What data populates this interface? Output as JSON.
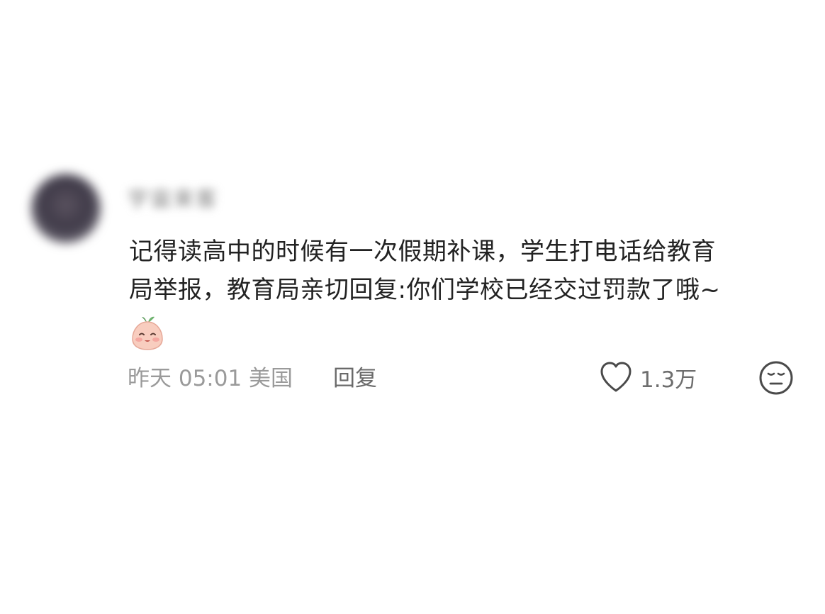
{
  "comment": {
    "username": "宇宙来客",
    "text_lines": [
      "记得读高中的时候有一次假期补课，学生打电话给教育",
      "局举报，教育局亲切回复:你们学校已经交过罚款了哦~"
    ],
    "emoji_icon": "smiling-peach-emoji-icon",
    "timestamp": "昨天 05:01 美国",
    "reply_label": "回复",
    "like_count": "1.3万",
    "like_icon": "heart-outline-icon",
    "reaction_icon": "expressionless-face-icon"
  },
  "colors": {
    "text": "#222222",
    "meta": "#9a9a9a",
    "emoji_pink": "#f6c2b8"
  }
}
